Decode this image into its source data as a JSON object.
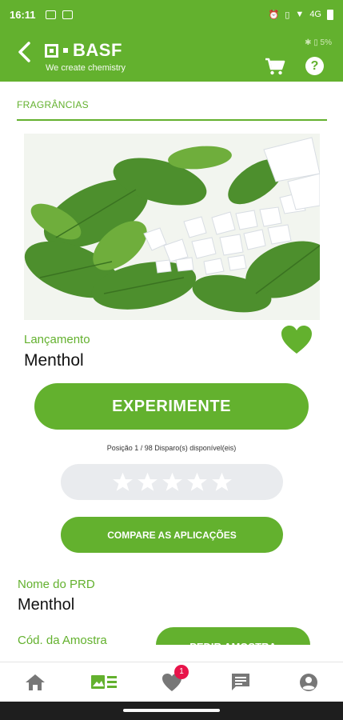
{
  "status_bar": {
    "time": "16:11",
    "right_text": "4G"
  },
  "header": {
    "logo_text": "BASF",
    "tagline": "We create chemistry",
    "bluetooth_status": "5%"
  },
  "section": {
    "title": "FRAGRÂNCIAS"
  },
  "product": {
    "launch_label": "Lançamento",
    "name": "Menthol",
    "try_button": "EXPERIMENTE",
    "position_text": "Posição 1 / 98 Disparo(s) disponível(eis)",
    "rating_stars": 5,
    "rating_value": 0,
    "compare_button": "COMPARE AS APLICAÇÕES",
    "prd_label": "Nome do PRD",
    "prd_value": "Menthol",
    "sample_label": "Cód. da Amostra",
    "request_button": "PEDIR AMOSTRA"
  },
  "bottom_nav": {
    "items": [
      "home",
      "catalog",
      "favorites",
      "messages",
      "profile"
    ],
    "active": "catalog",
    "favorites_badge": "1"
  },
  "colors": {
    "brand_green": "#63b12e",
    "badge_red": "#e8144a"
  }
}
